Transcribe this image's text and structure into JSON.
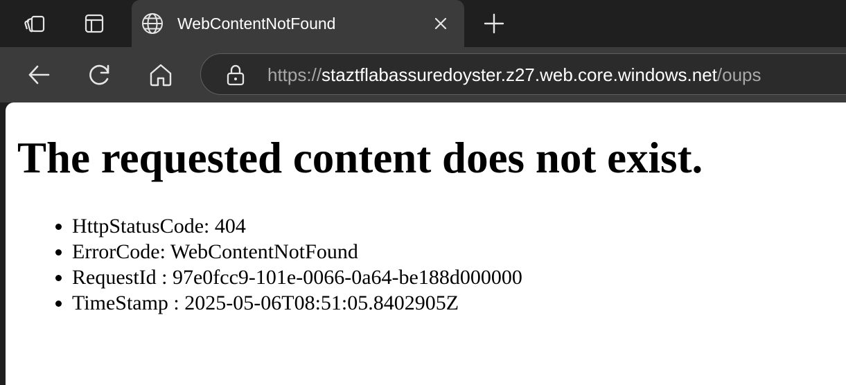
{
  "browser": {
    "tab": {
      "title": "WebContentNotFound"
    },
    "address": {
      "scheme": "https://",
      "host": "staztflabassuredoyster.z27.web.core.windows.net",
      "path": "/oups"
    },
    "icons": {
      "workspaces": "workspaces-icon",
      "tab_actions": "tab-actions-icon",
      "globe": "globe-icon",
      "close": "close-icon",
      "new_tab": "plus-icon",
      "back": "back-arrow-icon",
      "refresh": "refresh-icon",
      "home": "home-icon",
      "site_info": "lock-icon"
    },
    "colors": {
      "tabbar_bg": "#1f1f1f",
      "toolbar_bg": "#3b3b3b",
      "page_bg": "#ffffff"
    }
  },
  "page": {
    "heading": "The requested content does not exist.",
    "details": [
      "HttpStatusCode: 404",
      "ErrorCode: WebContentNotFound",
      "RequestId : 97e0fcc9-101e-0066-0a64-be188d000000",
      "TimeStamp : 2025-05-06T08:51:05.8402905Z"
    ]
  }
}
